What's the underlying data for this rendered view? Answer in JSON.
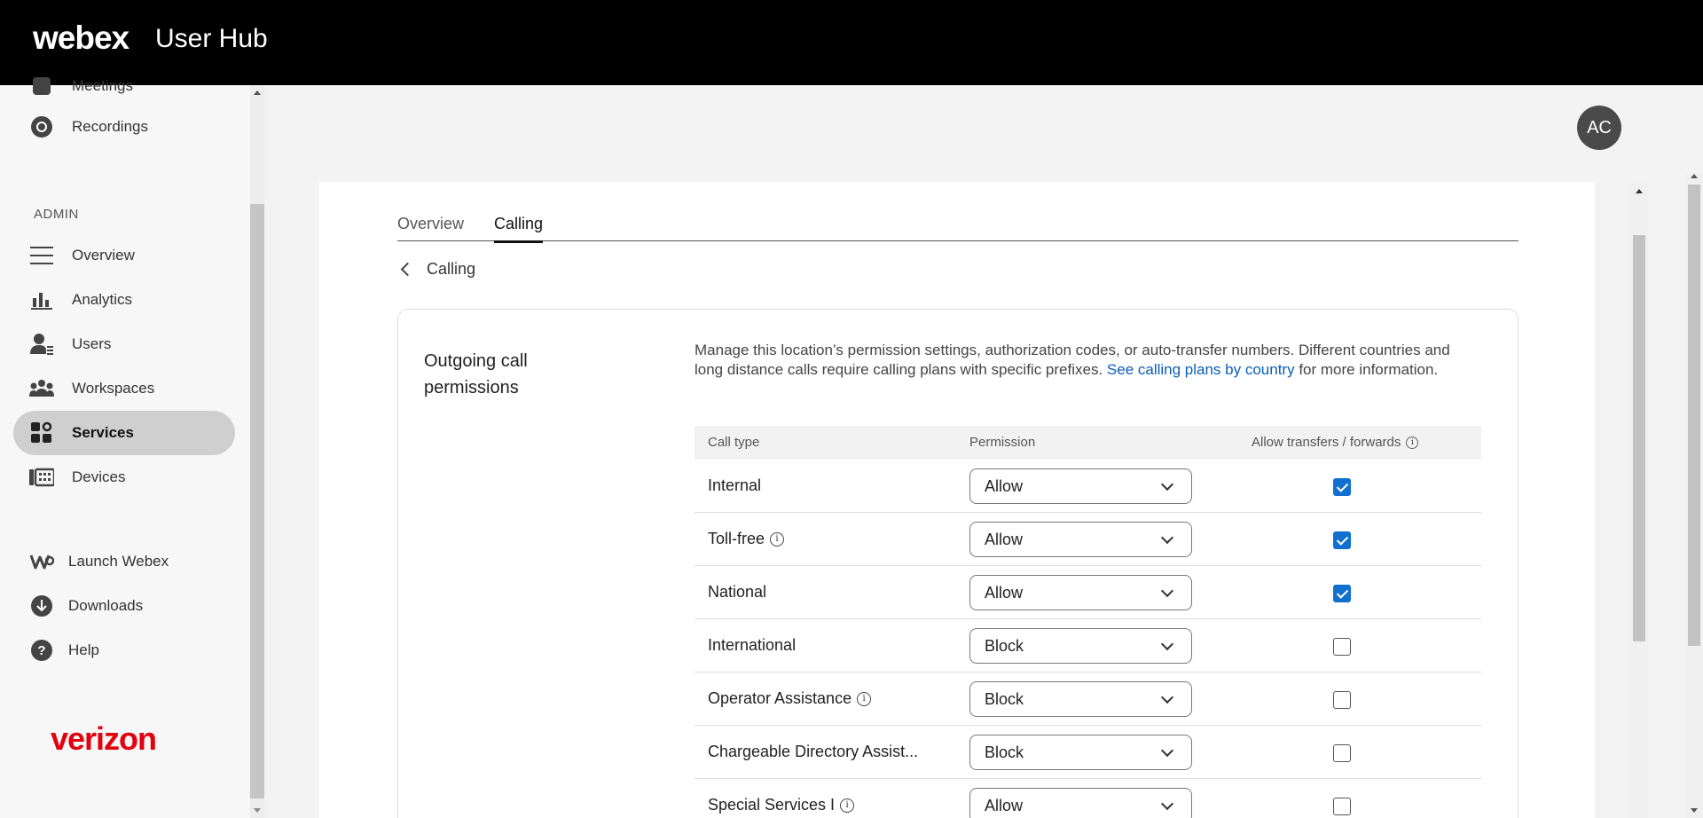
{
  "header": {
    "brand": "webex",
    "product": "User Hub"
  },
  "sidebar": {
    "top_items": [
      {
        "label": "Meetings",
        "icon": "meetings-icon"
      },
      {
        "label": "Recordings",
        "icon": "recordings-icon"
      }
    ],
    "section_label": "ADMIN",
    "admin_items": [
      {
        "label": "Overview",
        "icon": "menu-icon"
      },
      {
        "label": "Analytics",
        "icon": "analytics-icon"
      },
      {
        "label": "Users",
        "icon": "users-icon"
      },
      {
        "label": "Workspaces",
        "icon": "workspaces-icon"
      },
      {
        "label": "Services",
        "icon": "services-icon",
        "active": true
      },
      {
        "label": "Devices",
        "icon": "devices-icon"
      }
    ],
    "bottom_items": [
      {
        "label": "Launch Webex",
        "icon": "webex-logo-icon"
      },
      {
        "label": "Downloads",
        "icon": "download-icon"
      },
      {
        "label": "Help",
        "icon": "help-icon"
      }
    ],
    "partner_logo": "verizon"
  },
  "avatar": {
    "initials": "AC"
  },
  "tabs": [
    {
      "label": "Overview",
      "active": false
    },
    {
      "label": "Calling",
      "active": true
    }
  ],
  "back": {
    "label": "Calling"
  },
  "card": {
    "title": "Outgoing call permissions",
    "description": "Manage this location’s permission settings, authorization codes, or auto-transfer numbers. Different countries and long distance calls require calling plans with specific prefixes.",
    "link_text": "See calling plans by country",
    "description_suffix": "for more information."
  },
  "table": {
    "headers": {
      "call_type": "Call type",
      "permission": "Permission",
      "transfers": "Allow transfers / forwards"
    },
    "rows": [
      {
        "call_type": "Internal",
        "info": false,
        "permission": "Allow",
        "allow_transfer": true
      },
      {
        "call_type": "Toll-free",
        "info": true,
        "permission": "Allow",
        "allow_transfer": true
      },
      {
        "call_type": "National",
        "info": false,
        "permission": "Allow",
        "allow_transfer": true
      },
      {
        "call_type": "International",
        "info": false,
        "permission": "Block",
        "allow_transfer": false
      },
      {
        "call_type": "Operator Assistance",
        "info": true,
        "permission": "Block",
        "allow_transfer": false
      },
      {
        "call_type": "Chargeable Directory Assist...",
        "info": false,
        "permission": "Block",
        "allow_transfer": false
      },
      {
        "call_type": "Special Services I",
        "info": true,
        "permission": "Allow",
        "allow_transfer": false
      }
    ]
  },
  "colors": {
    "accent": "#1170cf",
    "link": "#0a5eb5",
    "header_bg": "#000000",
    "verizon_red": "#e3000f"
  }
}
